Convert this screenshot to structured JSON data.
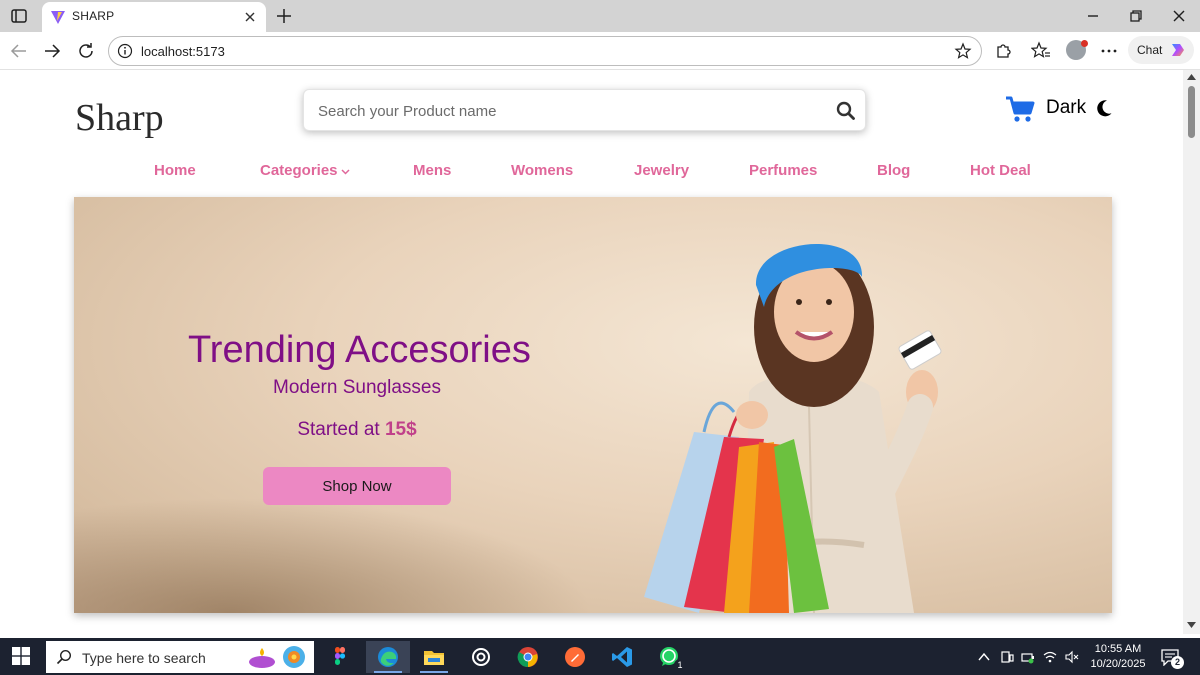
{
  "browser": {
    "tab_title": "SHARP",
    "url": "localhost:5173",
    "chat_label": "Chat",
    "icons": [
      "tab-actions-icon",
      "vite-favicon-icon",
      "close-icon",
      "plus-icon",
      "minimize-icon",
      "restore-icon",
      "close-window-icon",
      "back-icon",
      "forward-icon",
      "refresh-icon",
      "info-icon",
      "star-icon",
      "extensions-icon",
      "favorites-icon",
      "profile-icon",
      "more-icon",
      "copilot-icon"
    ]
  },
  "site": {
    "logo": "Sharp",
    "search_placeholder": "Search your Product name",
    "dark_label": "Dark",
    "nav": [
      {
        "label": "Home"
      },
      {
        "label": "Categories",
        "has_dropdown": true
      },
      {
        "label": "Mens"
      },
      {
        "label": "Womens"
      },
      {
        "label": "Jewelry"
      },
      {
        "label": "Perfumes"
      },
      {
        "label": "Blog"
      },
      {
        "label": "Hot Deal"
      }
    ],
    "hero": {
      "title": "Trending Accesories",
      "subtitle": "Modern Sunglasses",
      "price_prefix": "Started at ",
      "price": "15$",
      "cta": "Shop Now"
    },
    "colors": {
      "nav": "#e0679a",
      "hero_text": "#7f0f86",
      "price": "#c0408a",
      "cta_bg": "#ec88c3",
      "cart": "#1e6be6"
    }
  },
  "taskbar": {
    "search_text": "Type here to search",
    "apps": [
      "figma-icon",
      "edge-icon",
      "file-explorer-icon",
      "chatgpt-icon",
      "chrome-icon",
      "postman-icon",
      "vscode-icon",
      "whatsapp-icon"
    ],
    "whatsapp_badge": "1",
    "time": "10:55 AM",
    "date": "10/20/2025",
    "notification_count": "2"
  }
}
